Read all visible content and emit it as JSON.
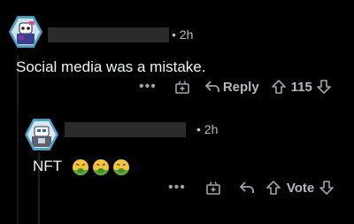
{
  "comments": [
    {
      "time": "2h",
      "text": "Social media was a mistake.",
      "actions": {
        "more": "•••",
        "reply": "Reply",
        "score": "115"
      }
    },
    {
      "time": "2h",
      "text": "NFT",
      "emoji_count": 3,
      "emoji_name": "nauseated-face",
      "actions": {
        "more": "•••",
        "vote": "Vote"
      }
    }
  ]
}
